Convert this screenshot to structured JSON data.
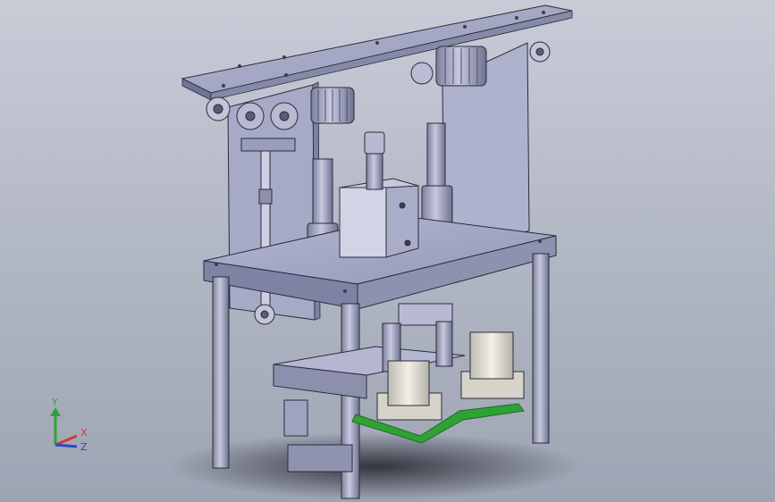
{
  "viewport": {
    "background_top": "#c9ccd7",
    "background_bottom": "#9ea4b3"
  },
  "model": {
    "body_color": "#a3a7c4",
    "shade_color": "#7d82a3",
    "edge_color": "#2a2c3a",
    "belt_color": "#2fa236",
    "cup_color": "#e8e6dc"
  },
  "triad": {
    "y_label": "Y",
    "x_label": "X",
    "z_label": "Z",
    "y_color": "#2fa236",
    "x_color": "#d23a2f",
    "z_color": "#2f47c8"
  }
}
